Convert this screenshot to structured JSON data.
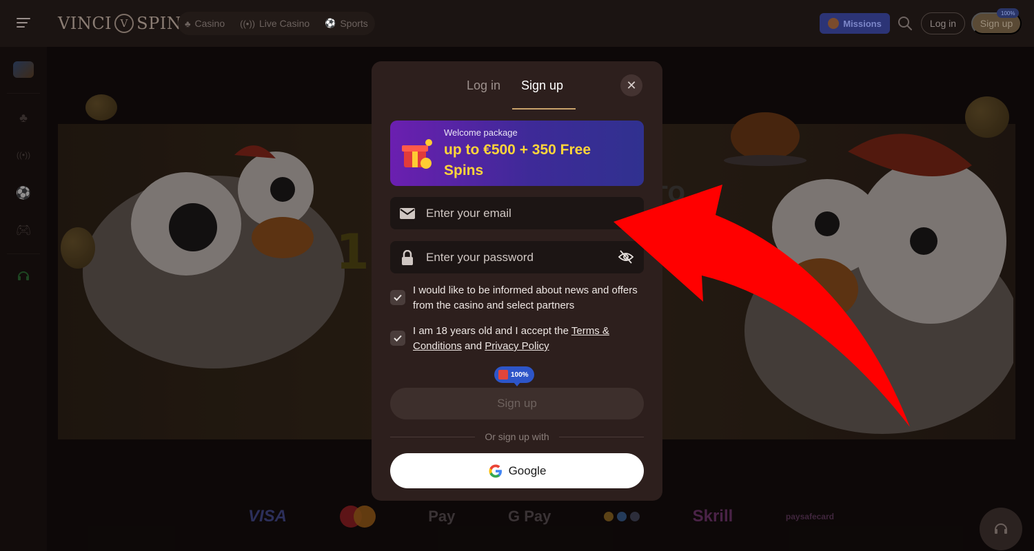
{
  "header": {
    "logo_left": "VINCI",
    "logo_mark": "V",
    "logo_right": "SPIN",
    "nav": [
      {
        "label": "Casino",
        "icon": "cherries-icon"
      },
      {
        "label": "Live Casino",
        "icon": "broadcast-icon"
      },
      {
        "label": "Sports",
        "icon": "soccer-ball-icon"
      }
    ],
    "missions_label": "Missions",
    "login_label": "Log in",
    "signup_label": "Sign up",
    "signup_badge": "100%"
  },
  "sidebar": {
    "items": [
      "game-controller-avatar-icon",
      "cherries-icon",
      "broadcast-icon",
      "soccer-ball-icon",
      "gamepad-icon",
      "headset-icon"
    ]
  },
  "banner": {
    "partial_text_right": "TO"
  },
  "modal": {
    "tabs": {
      "login": "Log in",
      "signup": "Sign up"
    },
    "promo": {
      "subtitle": "Welcome package",
      "title": "up to €500 + 350 Free Spins"
    },
    "email": {
      "placeholder": "Enter your email"
    },
    "password": {
      "placeholder": "Enter your password"
    },
    "consent_news": "I would like to be informed about news and offers from the casino and select partners",
    "consent_terms_prefix": "I am 18 years old and I accept the ",
    "terms_link": "Terms & Conditions",
    "consent_and": " and ",
    "privacy_link": "Privacy Policy",
    "bonus_badge": "100%",
    "submit_label": "Sign up",
    "or_text": "Or sign up with",
    "google_label": "Google"
  },
  "payments": {
    "visa": "VISA",
    "apple_pay": "Pay",
    "google_pay": "Pay",
    "skrill": "Skrill",
    "paysafecard": "paysafecard"
  },
  "colors": {
    "accent_gold": "#c9a26b",
    "promo_yellow": "#ffd53a",
    "modal_bg": "#2d1f1d",
    "arrow_red": "#ff0000"
  }
}
